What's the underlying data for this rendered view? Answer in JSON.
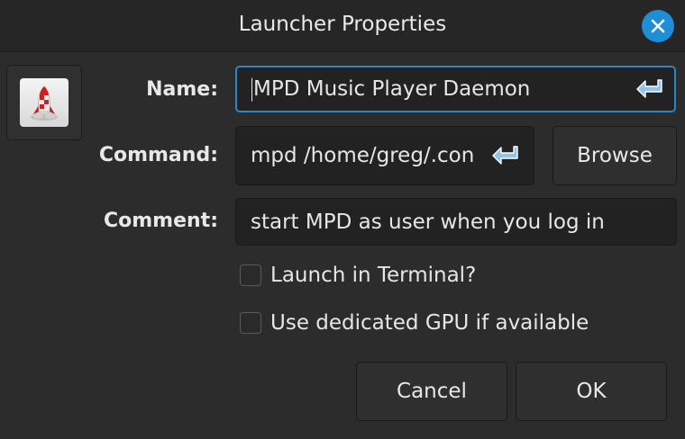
{
  "window": {
    "title": "Launcher Properties"
  },
  "icon_button": {
    "icon": "rocket-icon"
  },
  "form": {
    "name_label": "Name:",
    "name_value": "MPD Music Player Daemon",
    "command_label": "Command:",
    "command_value": "mpd /home/greg/.con",
    "comment_label": "Comment:",
    "comment_value": "start MPD as user when you log in"
  },
  "buttons": {
    "browse": "Browse",
    "cancel": "Cancel",
    "ok": "OK"
  },
  "checkboxes": {
    "terminal_label": "Launch in Terminal?",
    "terminal_checked": false,
    "gpu_label": "Use dedicated GPU if available",
    "gpu_checked": false
  },
  "colors": {
    "accent": "#1e8fd6",
    "background": "#2c2c2c",
    "field_background": "#222222"
  }
}
